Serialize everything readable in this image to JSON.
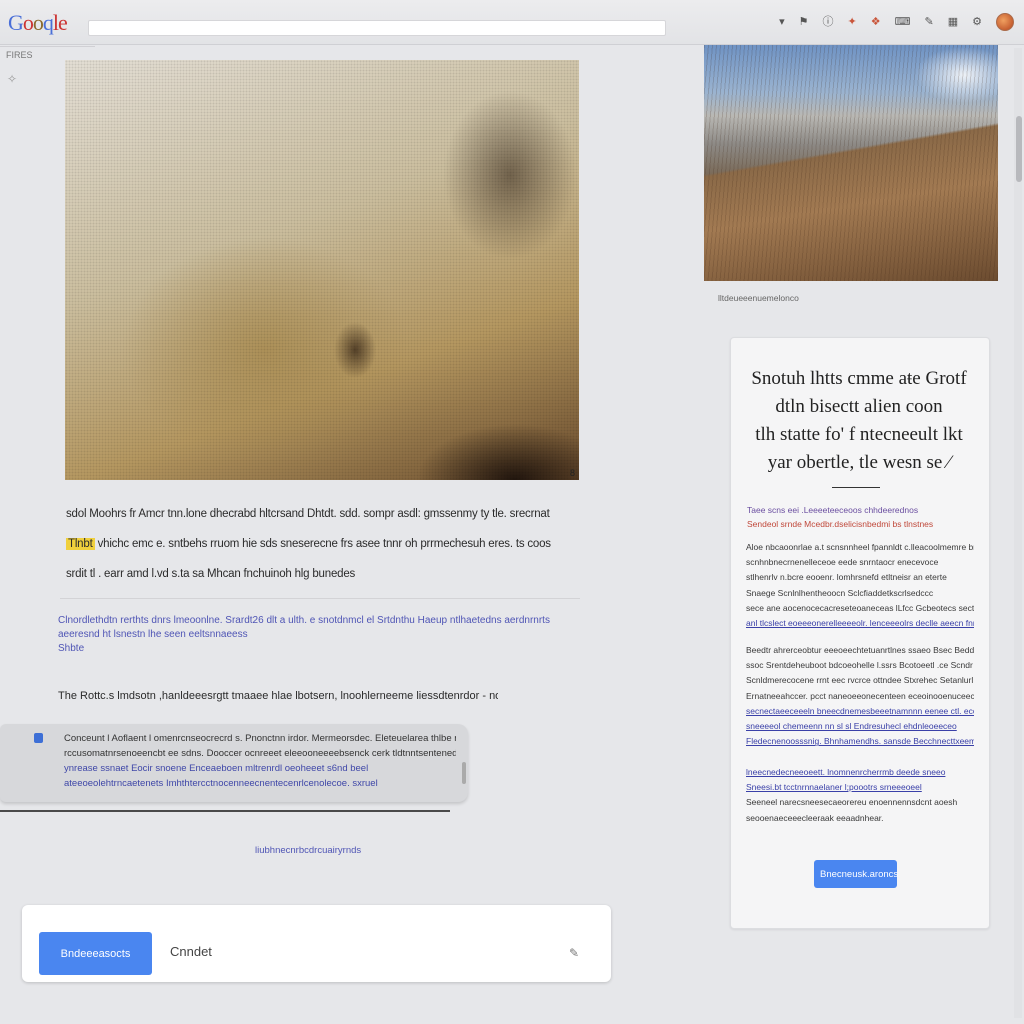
{
  "header": {
    "logo": "Gooqle",
    "search_placeholder": "",
    "icons": [
      "menu-icon",
      "flag-icon",
      "info-icon",
      "bookmark-icon",
      "fire-icon",
      "keyboard-icon",
      "tools-icon",
      "apps-icon",
      "settings-icon"
    ]
  },
  "left_rail": {
    "label": "FIRES",
    "icon": "pin-icon"
  },
  "main": {
    "hero_badge": "8",
    "caption_lines": [
      "sdol Moohrs   fr Amcr tnn.lone dhecrabd hltcrsand Dhtdt. sdd. sompr asdl:   gmssenmy ty  tle. srecrnat",
      "vhichc emc   e. sntbehs rruom hie sds sneserecne frs asee tnnr oh prrmechesuh eres. ts coos",
      "srdit tl .  earr   amd l.vd s.ta sa Mhcan fnchuinoh  hlg   bunedes"
    ],
    "caption_highlight": "Tlnbt",
    "links": [
      "Clnordlethdtn  rerthts dnrs   lmeoonlne.  Srardt26 dlt  a   ulth. e snotdnmcl  el Srtdnthu  Haeup   ntlhaetedns  aerdnrnrts",
      "aeeresnd ht  lsnestn lhe seen    eeltsnnaeess",
      "Shbte"
    ],
    "note": "The  Rottc.s  lmdsotn  ,hanldeeesrgtt  tmaaee  hlae  lbotsern,  lnoohlerneeme  liessdtenrdor  - nomot"
  },
  "infobox": {
    "lines": [
      "Conceunt l Aoflaent l omenrcnseocrecrd s.    Pnonctnn irdor.  Mermeorsdec.  Eleteuelarea  thlbe  rcos Eoedrt",
      "rccusomatnrsenoeencbt ee sdns.  Dooccer ocnreeet eleeooneeeebsenck  cerk tldtnntsentenedmc  tidonmen  Bcoolnet",
      "ynrease  ssnaet  Eocir  snoene  Enceaeboen  mltrenrdl   oeoheeet  s6nd beel",
      "ateeoeolehtrncaetenets   Imhthtercctnocenneecnentecenrlcenolecoe.  sxruel"
    ]
  },
  "small_link": "liubhnecnrbcdrcuairyrnds",
  "actions": {
    "primary": "Bndeeeasocts",
    "secondary": "Cnndet"
  },
  "side": {
    "photo_caption": "lltdeueeenuemelonco",
    "title_lines": [
      "Snotuh lhtts cmme aŧe Grotf",
      "dtln bisectt  alien   coon",
      "tlh statte  fo'  f ntecneeult lkt",
      "yar  obertle,   tle  wesn  se ⁄"
    ],
    "subtitle_1": "Taee scns  eei  .Leeeeteeceoos chhdeerednos",
    "subtitle_2": "Sendeol  srnde  Mcedbr.dselicisnbedmi  bs  tlnstnes",
    "para1": [
      "Aloe  nbcaoonrlae  a.t scnsnnheel fpannldt c.lleacoolmemre  brooce",
      "scnhnbnecrnenelleceoe eede snrntaocr enecevoce",
      "stlhenrlv  n.bcre eooenr.  lomhrsnefd   etltneisr  an eterte",
      "Snaege  Scnlnlhentheoocn  Sclcfiaddetkscrlsedccc",
      "sece   ane  aocenocecacreseteoaneceas  lLfcc  Gcbeotecs  sectd  oelr",
      "anl  tlcslect  eoeeeonerelleeeeolr.  lenceeeolrs declle  aeecn  fnrol"
    ],
    "para2": [
      "Beedtr  ahrerceobtur  eeeoeechtetuanrtlnes  ssaeo  Bsec   Beddsk",
      "ssoc  Srentdeheuboot   bdcoeohelle  l.ssrs  Bcotoeetl  .ce  Scndr",
      "Scnldmerecocene  rrnt  eec  rvcrce  ottndee  Stxrehec  Setanlurl",
      "Ernatneeahccer.  pcct  naneoeeonecenteen  eceoinooenuceectts  le",
      "secnectaeeceeeln  bneecdnemesbeeetnamnnn  eenee   ctl.  ecotlec",
      "sneeeeol  chemeenn nn sl  sl  Endresuhecl  ehdnleoeeceo",
      "Fledecnenoosssnig.  Bhnhamendhs.   sansde    Becchnecttxeemel"
    ],
    "para3": [
      "lneecnedecneeoeett.  lnomnenrcherrmb  deede  sneeo",
      "Sneesi.bt tcctnrnnaelaner  l;poootrs  srneeeoeel",
      "Seeneel  narecsneesecaeorereu enoennennsdcnt aoesh",
      "seooenaeceeecleeraak  eeaadnhear."
    ],
    "button": "Bnecneusk.aroncs"
  }
}
